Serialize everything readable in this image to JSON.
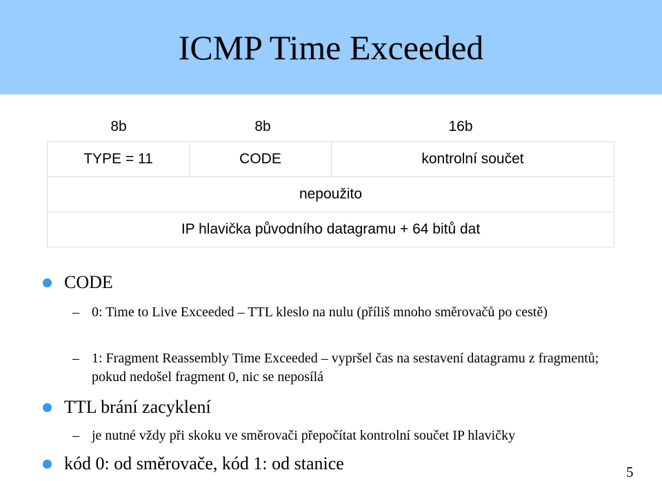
{
  "slide": {
    "title": "ICMP Time Exceeded",
    "page_number": "5",
    "accent_color": "#99ccff",
    "bullet_color": "#3399ee"
  },
  "packet": {
    "bit_widths": [
      "8b",
      "8b",
      "16b"
    ],
    "row1": [
      "TYPE = 11",
      "CODE",
      "kontrolní součet"
    ],
    "row2": "nepoužito",
    "row3": "IP hlavička původního datagramu + 64 bitů dat"
  },
  "bullets": [
    {
      "text": "CODE",
      "sub": [
        "0: Time to Live Exceeded – TTL kleslo na nulu (příliš mnoho směrovačů po cestě)",
        "1: Fragment Reassembly Time Exceeded – vypršel čas na sestavení datagramu z fragmentů; pokud nedošel fragment 0, nic se neposílá"
      ]
    },
    {
      "text": "TTL brání zacyklení",
      "sub": [
        "je nutné vždy při skoku ve směrovači přepočítat kontrolní součet IP hlavičky"
      ]
    },
    {
      "text": "kód 0: od směrovače, kód 1: od stanice",
      "sub": []
    }
  ],
  "dash_glyph": "–"
}
